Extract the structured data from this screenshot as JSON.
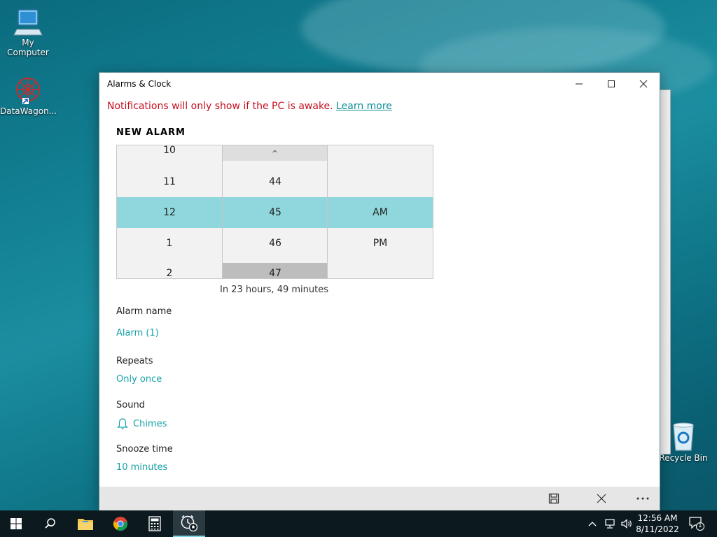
{
  "desktop": {
    "icons": [
      {
        "label": "My Computer"
      },
      {
        "label": "DataWagon..."
      },
      {
        "label": "Recycle Bin"
      }
    ]
  },
  "window": {
    "title": "Alarms & Clock",
    "minimize_icon": "minimize-icon",
    "maximize_icon": "maximize-icon",
    "close_icon": "close-icon",
    "notice_text": "Notifications will only show if the PC is awake.",
    "notice_link": "Learn more",
    "heading": "NEW ALARM",
    "picker": {
      "hours": [
        "10",
        "11",
        "12",
        "1",
        "2"
      ],
      "minutes": [
        "44",
        "45",
        "46",
        "47"
      ],
      "periods": [
        "AM",
        "PM"
      ],
      "selected": {
        "hour": "12",
        "minute": "45",
        "period": "AM"
      },
      "scroll_up_glyph": "^"
    },
    "countdown": "In 23 hours, 49 minutes",
    "alarm_name": {
      "label": "Alarm name",
      "value": "Alarm (1)"
    },
    "repeats": {
      "label": "Repeats",
      "value": "Only once"
    },
    "sound": {
      "label": "Sound",
      "value": "Chimes",
      "icon": "bell-icon"
    },
    "snooze": {
      "label": "Snooze time",
      "value": "10 minutes"
    },
    "command_bar": {
      "save_icon": "save-icon",
      "discard_icon": "close-icon",
      "more_icon": "more-icon"
    }
  },
  "taskbar": {
    "clock_time": "12:56 AM",
    "clock_date": "8/11/2022",
    "notification_count": "1",
    "accent": "#7fd1e6"
  },
  "colors": {
    "accent_teal": "#17a2a6",
    "selection": "#8fd7dc",
    "warning_red": "#c50f1f"
  }
}
